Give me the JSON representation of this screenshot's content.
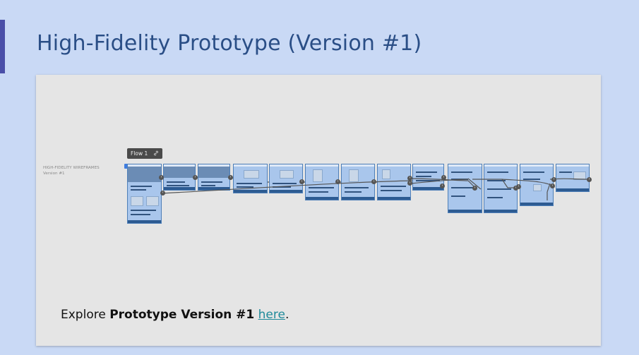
{
  "slide": {
    "title": "High-Fidelity Prototype (Version #1)",
    "accent_color": "#4a4fa8",
    "title_color": "#2a4e86",
    "background_color": "#c9d9f5"
  },
  "canvas": {
    "section_label_line1": "HIGH-FIDELITY WIREFRAMES",
    "section_label_line2": "Version #1",
    "flow_label": "Flow 1",
    "flow_icon": "link-icon",
    "frame_color": "#a9c6ec",
    "frame_count": 13
  },
  "footer": {
    "prefix": "Explore ",
    "bold": "Prototype Version #1",
    "link": "here",
    "suffix": "."
  }
}
